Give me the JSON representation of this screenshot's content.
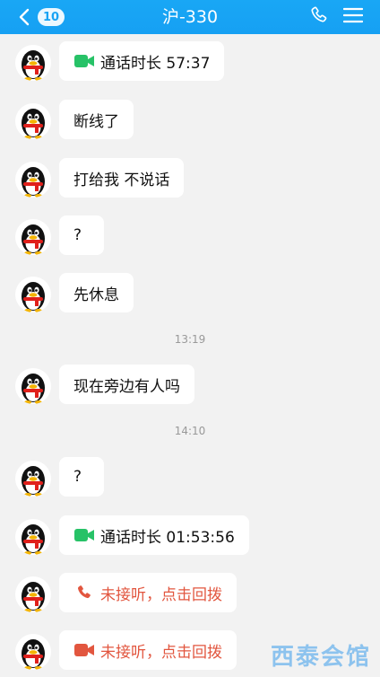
{
  "header": {
    "title": "沪-330",
    "unread_count": "10",
    "accent": "#18a3f4"
  },
  "messages": [
    {
      "type": "call",
      "icon": "video-call-icon",
      "text": "通话时长 57:37"
    },
    {
      "type": "text",
      "text": "断线了"
    },
    {
      "type": "text",
      "text": "打给我 不说话"
    },
    {
      "type": "text",
      "text": "?"
    },
    {
      "type": "text",
      "text": "先休息"
    },
    {
      "type": "timestamp",
      "text": "13:19"
    },
    {
      "type": "text",
      "text": "现在旁边有人吗"
    },
    {
      "type": "timestamp",
      "text": "14:10"
    },
    {
      "type": "text",
      "text": "?"
    },
    {
      "type": "call",
      "icon": "video-call-icon",
      "text": "通话时长 01:53:56"
    },
    {
      "type": "missed-call",
      "icon": "missed-phone-icon",
      "text": "未接听，点击回拨"
    },
    {
      "type": "missed-call",
      "icon": "missed-video-icon",
      "text": "未接听，点击回拨"
    }
  ],
  "colors": {
    "call_icon_green": "#27c267",
    "missed_red": "#e2563f"
  },
  "watermark": "西泰会馆"
}
